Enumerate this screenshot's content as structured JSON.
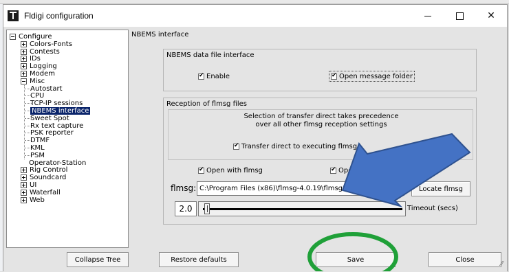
{
  "window": {
    "title": "Fldigi configuration"
  },
  "tree": {
    "items": [
      {
        "label": "Configure",
        "expander": "minus"
      },
      {
        "label": "Colors-Fonts",
        "expander": "plus"
      },
      {
        "label": "Contests",
        "expander": "plus"
      },
      {
        "label": "IDs",
        "expander": "plus"
      },
      {
        "label": "Logging",
        "expander": "plus"
      },
      {
        "label": "Modem",
        "expander": "plus"
      },
      {
        "label": "Misc",
        "expander": "minus"
      },
      {
        "label": "Autostart",
        "expander": "none"
      },
      {
        "label": "CPU",
        "expander": "none"
      },
      {
        "label": "TCP-IP sessions",
        "expander": "none"
      },
      {
        "label": "NBEMS interface",
        "expander": "none",
        "selected": true
      },
      {
        "label": "Sweet Spot",
        "expander": "none"
      },
      {
        "label": "Rx text capture",
        "expander": "none"
      },
      {
        "label": "PSK reporter",
        "expander": "none"
      },
      {
        "label": "DTMF",
        "expander": "none"
      },
      {
        "label": "KML",
        "expander": "none"
      },
      {
        "label": "PSM",
        "expander": "none"
      },
      {
        "label": "Operator-Station",
        "expander": "none"
      },
      {
        "label": "Rig Control",
        "expander": "plus"
      },
      {
        "label": "Soundcard",
        "expander": "plus"
      },
      {
        "label": "UI",
        "expander": "plus"
      },
      {
        "label": "Waterfall",
        "expander": "plus"
      },
      {
        "label": "Web",
        "expander": "plus"
      }
    ]
  },
  "panel": {
    "title": "NBEMS interface",
    "data_file_group": {
      "title": "NBEMS data file interface",
      "enable_label": "Enable",
      "enable_checked": true,
      "open_folder_label": "Open message folder",
      "open_folder_checked": true
    },
    "reception_group": {
      "title": "Reception of flmsg files",
      "note_line1": "Selection of transfer direct takes precedence",
      "note_line2": "over all other flmsg reception settings",
      "transfer_direct_label": "Transfer direct to executing flmsg",
      "transfer_direct_checked": true,
      "open_with_label": "Open with flmsg",
      "open_with_checked": true,
      "open_browser_label": "Open",
      "open_browser_checked": true,
      "flmsg_label": "flmsg:",
      "flmsg_path": "C:\\Program Files (x86)\\flmsg-4.0.19\\flmsg.exe",
      "locate_label": "Locate flmsg",
      "timeout_value": "2.0",
      "timeout_label": "Timeout (secs)",
      "timeout_fraction": 0.0
    }
  },
  "buttons": {
    "collapse_tree": "Collapse Tree",
    "restore_defaults": "Restore defaults",
    "save": "Save",
    "close": "Close"
  },
  "colors": {
    "selection": "#0a246a",
    "annotation_arrow": "#4472c4",
    "annotation_circle": "#1fa038"
  }
}
